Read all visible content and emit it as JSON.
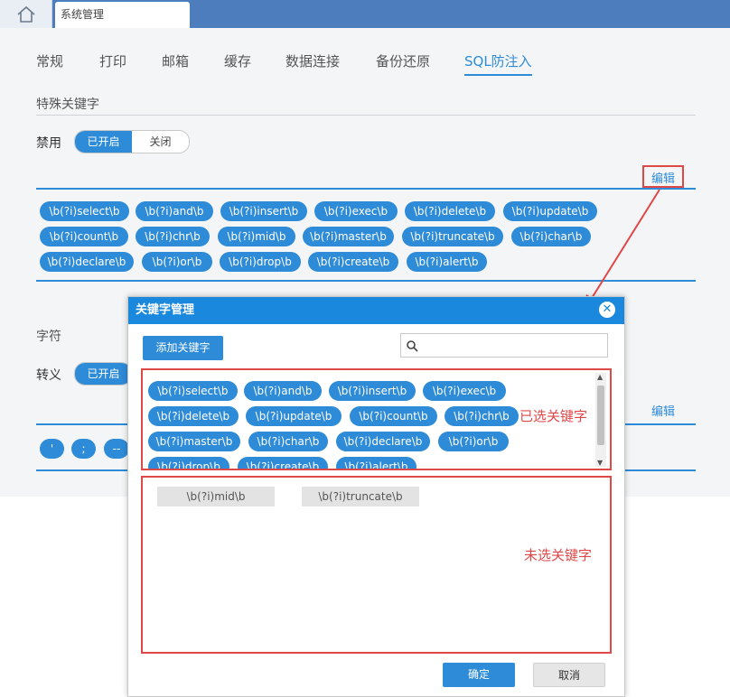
{
  "topbar": {
    "home_icon": "home-icon",
    "tab_label": "系统管理",
    "color": "#4e7dbd"
  },
  "nav_tabs": [
    {
      "label": "常规",
      "active": false
    },
    {
      "label": "打印",
      "active": false
    },
    {
      "label": "邮箱",
      "active": false
    },
    {
      "label": "缓存",
      "active": false
    },
    {
      "label": "数据连接",
      "active": false
    },
    {
      "label": "备份还原",
      "active": false
    },
    {
      "label": "SQL防注入",
      "active": true
    }
  ],
  "special_keywords": {
    "title": "特殊关键字",
    "disable_label": "禁用",
    "toggle_on": "已开启",
    "toggle_off": "关闭",
    "edit": "编辑",
    "chips": [
      "\\b(?i)select\\b",
      "\\b(?i)and\\b",
      "\\b(?i)insert\\b",
      "\\b(?i)exec\\b",
      "\\b(?i)delete\\b",
      "\\b(?i)update\\b",
      "\\b(?i)count\\b",
      "\\b(?i)chr\\b",
      "\\b(?i)mid\\b",
      "\\b(?i)master\\b",
      "\\b(?i)truncate\\b",
      "\\b(?i)char\\b",
      "\\b(?i)declare\\b",
      "\\b(?i)or\\b",
      "\\b(?i)drop\\b",
      "\\b(?i)create\\b",
      "\\b(?i)alert\\b"
    ]
  },
  "characters": {
    "title": "字符",
    "escape_label": "转义",
    "toggle_on": "已开启",
    "edit": "编辑",
    "chips": [
      "'",
      ";",
      "--"
    ]
  },
  "modal": {
    "title": "关键字管理",
    "add_button": "添加关键字",
    "search_placeholder": "",
    "selected_chips": [
      "\\b(?i)select\\b",
      "\\b(?i)and\\b",
      "\\b(?i)insert\\b",
      "\\b(?i)exec\\b",
      "\\b(?i)delete\\b",
      "\\b(?i)update\\b",
      "\\b(?i)count\\b",
      "\\b(?i)chr\\b",
      "\\b(?i)master\\b",
      "\\b(?i)char\\b",
      "\\b(?i)declare\\b",
      "\\b(?i)or\\b",
      "\\b(?i)drop\\b",
      "\\b(?i)create\\b",
      "\\b(?i)alert\\b"
    ],
    "unselected_chips": [
      "\\b(?i)mid\\b",
      "\\b(?i)truncate\\b"
    ],
    "ok": "确定",
    "cancel": "取消",
    "header_color": "#1a88dc"
  },
  "annotations": {
    "selected": "已选关键字",
    "unselected": "未选关键字",
    "color": "#e04848"
  }
}
